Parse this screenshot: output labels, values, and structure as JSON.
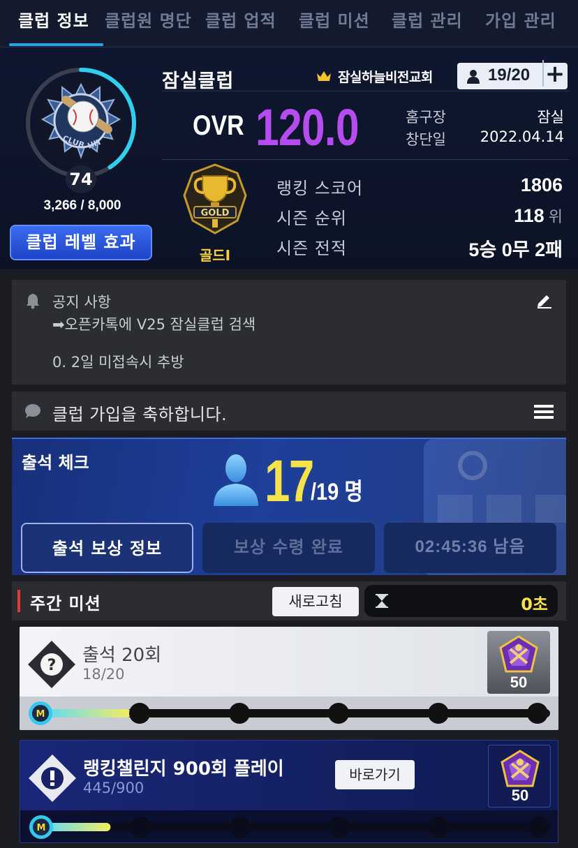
{
  "tabs": [
    {
      "label": "클럽 정보",
      "active": true
    },
    {
      "label": "클럽원 명단"
    },
    {
      "label": "클럽 업적"
    },
    {
      "label": "클럽 미션"
    },
    {
      "label": "클럽 관리"
    },
    {
      "label": "가입 관리"
    }
  ],
  "club": {
    "name": "잠실클럽",
    "level": "74",
    "xp": "3,266 / 8,000",
    "xp_progress": 0.408,
    "level_effect_button": "클럽 레벨 효과",
    "owner": "잠실하늘비전교회",
    "members": "19/20",
    "add_label": "+",
    "ovr_label": "OVR",
    "ovr_value": "120.0",
    "home_label": "홈구장",
    "home_value": "잠실",
    "founded_label": "창단일",
    "founded_value": "2022.04.14",
    "emblem_text": [
      "CLUB",
      "HIT"
    ]
  },
  "tier": {
    "name": "골드I",
    "badge_text": "GOLD"
  },
  "stats": [
    {
      "label": "랭킹 스코어",
      "value": "1806",
      "unit": ""
    },
    {
      "label": "시즌 순위",
      "value": "118",
      "unit": " 위"
    },
    {
      "label": "시즌 전적",
      "value": "5승 0무 2패",
      "unit": ""
    }
  ],
  "notice": {
    "title": "공지 사항",
    "line1": "➡오픈카톡에 V25 잠실클럽 검색",
    "line2": "0. 2일 미접속시 추방"
  },
  "chat": {
    "text": "클럽 가입을 축하합니다."
  },
  "attendance": {
    "title": "출석 체크",
    "count": "17",
    "total": "/19 명",
    "reward_info_button": "출석 보상 정보",
    "reward_claimed_button": "보상 수령 완료",
    "time_remaining": "02:45:36 남음"
  },
  "weekly": {
    "title": "주간 미션",
    "refresh_button": "새로고침",
    "timer": "0초"
  },
  "missions": [
    {
      "title": "출석 20회",
      "progress": "18/20",
      "fraction": 0.9,
      "reward": "50",
      "icon": "question-icon",
      "milestone_badge": "M"
    },
    {
      "title": "랭킹챌린지 900회 플레이",
      "progress": "445/900",
      "fraction": 0.494,
      "reward": "50",
      "icon": "exclamation-icon",
      "goto_button": "바로가기",
      "milestone_badge": "M"
    }
  ],
  "colors": {
    "accent": "#2aa4e6",
    "ovr": "#b54cf0",
    "highlight": "#f7e24a"
  }
}
